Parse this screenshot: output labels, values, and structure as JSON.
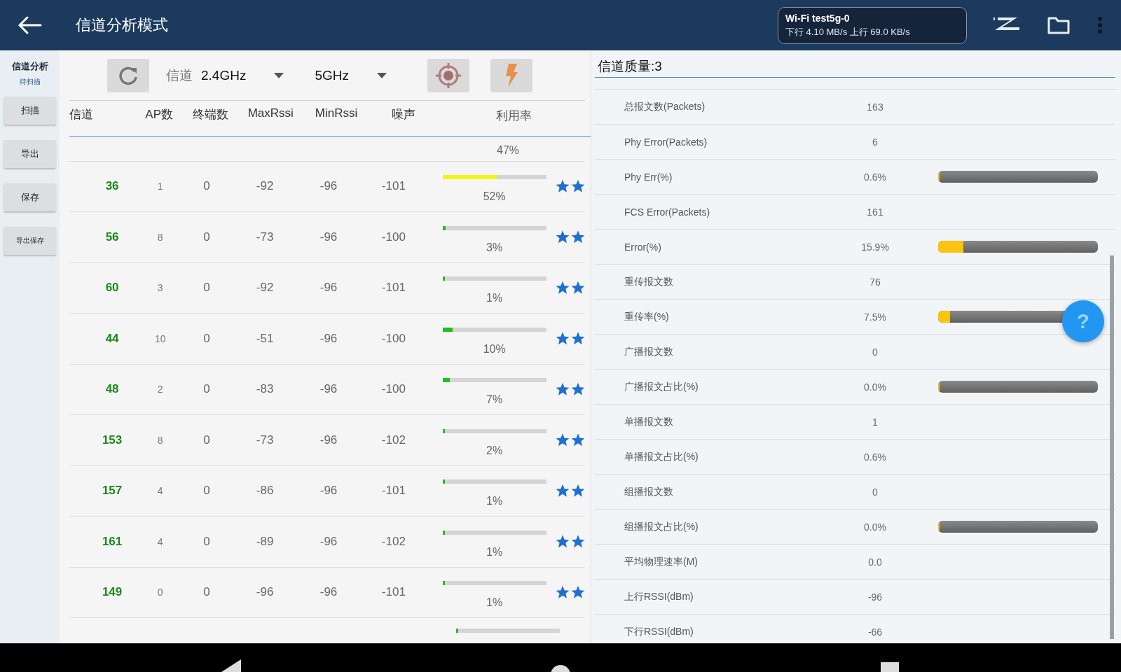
{
  "app_bar": {
    "title": "信道分析模式",
    "wifi": {
      "name": "Wi-Fi test5g-0",
      "rates": "下行 4.10 MB/s 上行 69.0 KB/s"
    }
  },
  "sidebar": {
    "title": "信道分析",
    "status": "待扫描",
    "buttons": [
      "扫描",
      "导出",
      "保存",
      "导出保存"
    ]
  },
  "toolbar": {
    "label": "信道",
    "band_24": "2.4GHz",
    "band_5": "5GHz"
  },
  "table": {
    "columns": [
      "信道",
      "AP数",
      "终端数",
      "MaxRssi",
      "MinRssi",
      "噪声",
      "利用率"
    ],
    "rows": [
      {
        "partial": true,
        "util": "47%"
      },
      {
        "channel": "36",
        "ap": "1",
        "clients": "0",
        "max": "-92",
        "min": "-96",
        "noise": "-101",
        "level": 0.52,
        "util": "52%"
      },
      {
        "channel": "56",
        "ap": "8",
        "clients": "0",
        "max": "-73",
        "min": "-96",
        "noise": "-100",
        "level": 0.03,
        "util": "3%"
      },
      {
        "channel": "60",
        "ap": "3",
        "clients": "0",
        "max": "-92",
        "min": "-96",
        "noise": "-101",
        "level": 0.01,
        "util": "1%"
      },
      {
        "channel": "44",
        "ap": "10",
        "clients": "0",
        "max": "-51",
        "min": "-96",
        "noise": "-100",
        "level": 0.1,
        "util": "10%"
      },
      {
        "channel": "48",
        "ap": "2",
        "clients": "0",
        "max": "-83",
        "min": "-96",
        "noise": "-100",
        "level": 0.07,
        "util": "7%"
      },
      {
        "channel": "153",
        "ap": "8",
        "clients": "0",
        "max": "-73",
        "min": "-96",
        "noise": "-102",
        "level": 0.02,
        "util": "2%"
      },
      {
        "channel": "157",
        "ap": "4",
        "clients": "0",
        "max": "-86",
        "min": "-96",
        "noise": "-101",
        "level": 0.01,
        "util": "1%"
      },
      {
        "channel": "161",
        "ap": "4",
        "clients": "0",
        "max": "-89",
        "min": "-96",
        "noise": "-102",
        "level": 0.01,
        "util": "1%"
      },
      {
        "channel": "149",
        "ap": "0",
        "clients": "0",
        "max": "-96",
        "min": "-96",
        "noise": "-101",
        "level": 0.01,
        "util": "1%"
      },
      {
        "partial": true,
        "level": 0
      }
    ]
  },
  "quality": {
    "title": "信道质量:3",
    "rows": [
      {
        "label": "总报文数(Packets)",
        "value": "163"
      },
      {
        "label": "Phy Error(Packets)",
        "value": "6"
      },
      {
        "label": "Phy Err(%)",
        "value": "0.6%",
        "level": 0.006
      },
      {
        "label": "FCS Error(Packets)",
        "value": "161"
      },
      {
        "label": "Error(%)",
        "value": "15.9%",
        "level": 0.159
      },
      {
        "label": "重传报文数",
        "value": "76"
      },
      {
        "label": "重传率(%)",
        "value": "7.5%",
        "level": 0.075
      },
      {
        "label": "广播报文数",
        "value": "0"
      },
      {
        "label": "广播报文占比(%)",
        "value": "0.0%",
        "level": 0
      },
      {
        "label": "单播报文数",
        "value": "1"
      },
      {
        "label": "单播报文占比(%)",
        "value": "0.6%"
      },
      {
        "label": "组播报文数",
        "value": "0"
      },
      {
        "label": "组播报文占比(%)",
        "value": "0.0%",
        "level": 0
      },
      {
        "label": "平均物理速率(M)",
        "value": "0.0"
      },
      {
        "label": "上行RSSI(dBm)",
        "value": "-96"
      },
      {
        "label": "下行RSSI(dBm)",
        "value": "-66"
      }
    ]
  },
  "help_button": {
    "label": "?"
  }
}
